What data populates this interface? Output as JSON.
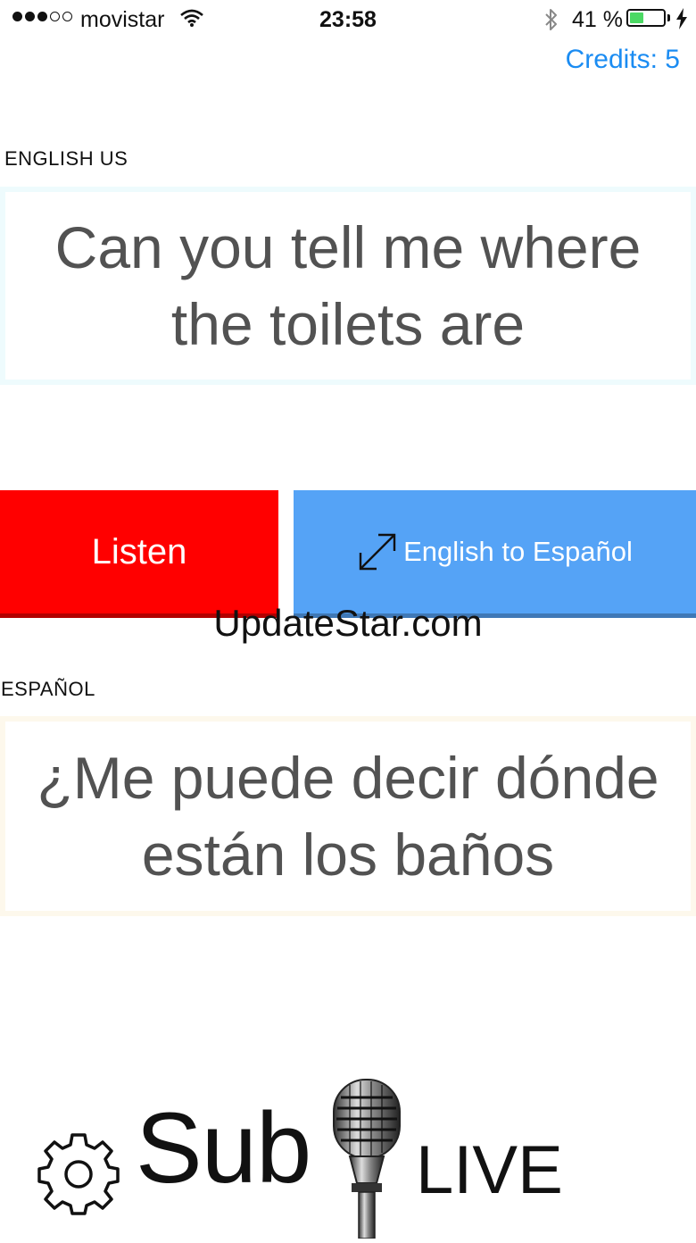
{
  "status_bar": {
    "carrier": "movistar",
    "time": "23:58",
    "battery_percent": "41 %",
    "battery_level": 0.41
  },
  "header": {
    "credits": "Credits: 5"
  },
  "source": {
    "language": "ENGLISH US",
    "text": "Can you tell me where the toilets are"
  },
  "buttons": {
    "listen": "Listen",
    "translate": "English to Español"
  },
  "watermark": "UpdateStar.com",
  "target": {
    "language": "ESPAÑOL",
    "text": "¿Me puede decir dónde están los baños"
  },
  "logo": {
    "sub": "Sub",
    "live": "LIVE"
  },
  "colors": {
    "accent": "#1b8cf2",
    "listen": "#ff0000",
    "translate": "#55a3f6",
    "battery": "#4cd964"
  },
  "icons": [
    "wifi-icon",
    "bluetooth-icon",
    "battery-icon",
    "charging-bolt-icon",
    "swap-arrows-icon",
    "gear-icon",
    "microphone-icon"
  ]
}
